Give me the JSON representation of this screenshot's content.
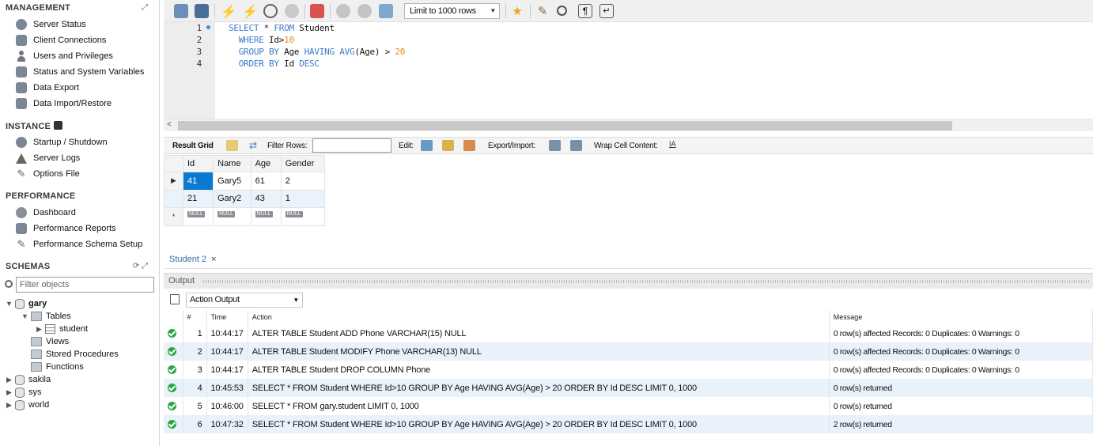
{
  "sidebar": {
    "management_header": "MANAGEMENT",
    "management": [
      "Server Status",
      "Client Connections",
      "Users and Privileges",
      "Status and System Variables",
      "Data Export",
      "Data Import/Restore"
    ],
    "instance_header": "INSTANCE",
    "instance": [
      "Startup / Shutdown",
      "Server Logs",
      "Options File"
    ],
    "performance_header": "PERFORMANCE",
    "performance": [
      "Dashboard",
      "Performance Reports",
      "Performance Schema Setup"
    ],
    "schemas_header": "SCHEMAS",
    "filter_placeholder": "Filter objects",
    "tree": {
      "gary": "gary",
      "tables": "Tables",
      "student": "student",
      "views": "Views",
      "procs": "Stored Procedures",
      "funcs": "Functions",
      "sakila": "sakila",
      "sys": "sys",
      "world": "world"
    }
  },
  "toolbar": {
    "limit_label": "Limit to 1000 rows"
  },
  "editor": {
    "line_numbers": [
      "1",
      "2",
      "3",
      "4"
    ],
    "lines": [
      [
        {
          "t": "SELECT",
          "c": "kw"
        },
        {
          "t": " * ",
          "c": ""
        },
        {
          "t": "FROM",
          "c": "kw"
        },
        {
          "t": " Student",
          "c": ""
        }
      ],
      [
        {
          "t": "  WHERE",
          "c": "kw"
        },
        {
          "t": " Id>",
          "c": ""
        },
        {
          "t": "10",
          "c": "num"
        }
      ],
      [
        {
          "t": "  GROUP BY",
          "c": "kw"
        },
        {
          "t": " Age ",
          "c": ""
        },
        {
          "t": "HAVING",
          "c": "kw"
        },
        {
          "t": " ",
          "c": ""
        },
        {
          "t": "AVG",
          "c": "kw"
        },
        {
          "t": "(Age) > ",
          "c": ""
        },
        {
          "t": "20",
          "c": "num"
        }
      ],
      [
        {
          "t": "  ORDER BY",
          "c": "kw"
        },
        {
          "t": " Id ",
          "c": ""
        },
        {
          "t": "DESC",
          "c": "kw"
        }
      ]
    ]
  },
  "results_toolbar": {
    "result_grid": "Result Grid",
    "filter_rows": "Filter Rows:",
    "edit": "Edit:",
    "export": "Export/Import:",
    "wrap": "Wrap Cell Content:"
  },
  "grid": {
    "columns": [
      "Id",
      "Name",
      "Age",
      "Gender"
    ],
    "rows": [
      [
        "41",
        "Gary5",
        "61",
        "2"
      ],
      [
        "21",
        "Gary2",
        "43",
        "1"
      ]
    ],
    "null_label": "NULL",
    "new_row_marker": "*"
  },
  "result_tab": {
    "label": "Student 2",
    "close": "×"
  },
  "output": {
    "header": "Output",
    "selector": "Action Output",
    "columns": [
      "#",
      "Time",
      "Action",
      "Message"
    ],
    "rows": [
      [
        "1",
        "10:44:17",
        "ALTER TABLE Student ADD Phone VARCHAR(15) NULL",
        "0 row(s) affected Records: 0  Duplicates: 0  Warnings: 0"
      ],
      [
        "2",
        "10:44:17",
        "ALTER TABLE Student MODIFY Phone VARCHAR(13) NULL",
        "0 row(s) affected Records: 0  Duplicates: 0  Warnings: 0"
      ],
      [
        "3",
        "10:44:17",
        "ALTER TABLE Student DROP COLUMN Phone",
        "0 row(s) affected Records: 0  Duplicates: 0  Warnings: 0"
      ],
      [
        "4",
        "10:45:53",
        "SELECT * FROM Student   WHERE Id>10   GROUP BY Age HAVING AVG(Age) > 20   ORDER BY Id DESC LIMIT 0, 1000",
        "0 row(s) returned"
      ],
      [
        "5",
        "10:46:00",
        "SELECT * FROM gary.student LIMIT 0, 1000",
        "0 row(s) returned"
      ],
      [
        "6",
        "10:47:32",
        "SELECT * FROM Student   WHERE Id>10   GROUP BY Age HAVING AVG(Age) > 20   ORDER BY Id DESC LIMIT 0, 1000",
        "2 row(s) returned"
      ]
    ]
  }
}
